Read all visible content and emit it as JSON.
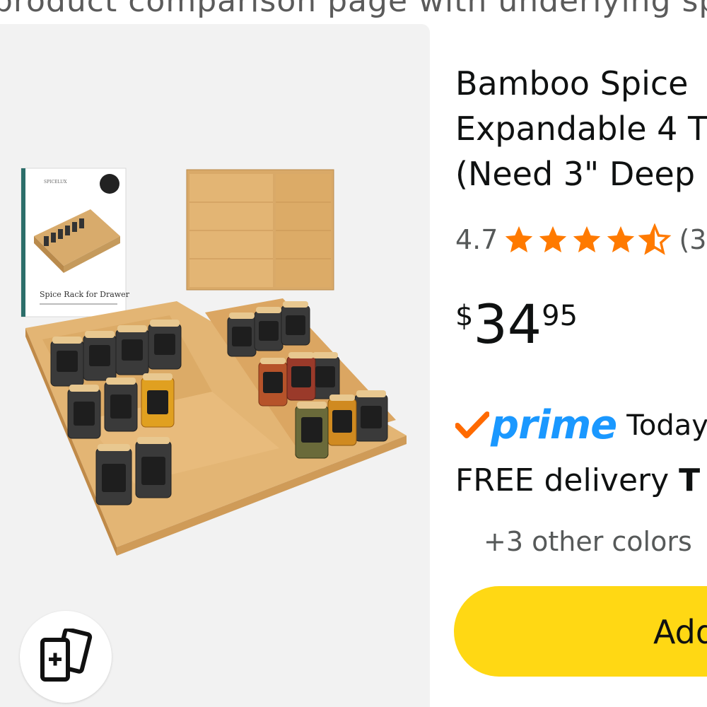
{
  "header": {
    "strip_text": "product comparison page with underlying specs"
  },
  "product": {
    "title_lines": [
      "Bamboo Spice",
      "Expandable 4 T",
      "(Need 3\" Deep"
    ],
    "box_label": "Spice Rack for Drawer",
    "box_brand": "SPICELUX",
    "rating": {
      "value": "4.7",
      "stars": 4.5,
      "count": "(3"
    },
    "price": {
      "symbol": "$",
      "whole": "34",
      "fraction": "95"
    },
    "prime": {
      "label": "prime",
      "today": "Today"
    },
    "delivery": {
      "prefix": "FREE delivery ",
      "bold": "T"
    },
    "other_colors": "+3 other colors",
    "add_to_cart": "Add"
  },
  "icons": {
    "compare": "compare-cards-icon",
    "prime_check": "prime-check-icon",
    "star": "star-icon"
  },
  "colors": {
    "accent_star": "#ff7a00",
    "prime_blue": "#1a98ff",
    "prime_check": "#ff6a00",
    "add_button": "#ffd814",
    "image_bg": "#f2f2f2"
  }
}
